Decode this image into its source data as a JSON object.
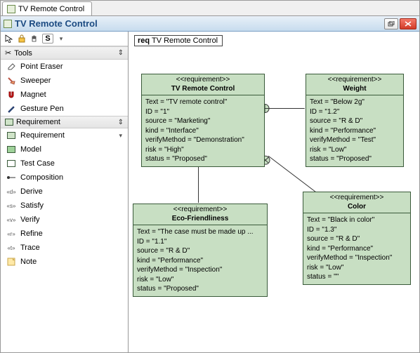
{
  "tab_title": "TV Remote Control",
  "window_title": "TV Remote Control",
  "toolstrip": {
    "lock": "S"
  },
  "sidebar": {
    "tools_header": "Tools",
    "tools": [
      {
        "label": "Point Eraser",
        "icon": "eraser-icon"
      },
      {
        "label": "Sweeper",
        "icon": "sweeper-icon"
      },
      {
        "label": "Magnet",
        "icon": "magnet-icon"
      },
      {
        "label": "Gesture Pen",
        "icon": "pen-icon"
      }
    ],
    "req_header": "Requirement",
    "req_items": [
      {
        "label": "Requirement",
        "icon": "req-icon"
      },
      {
        "label": "Model",
        "icon": "model-icon"
      },
      {
        "label": "Test Case",
        "icon": "testcase-icon"
      },
      {
        "label": "Composition",
        "icon": "composition-icon"
      },
      {
        "label": "Derive",
        "icon": "derive-icon"
      },
      {
        "label": "Satisfy",
        "icon": "satisfy-icon"
      },
      {
        "label": "Verify",
        "icon": "verify-icon"
      },
      {
        "label": "Refine",
        "icon": "refine-icon"
      },
      {
        "label": "Trace",
        "icon": "trace-icon"
      },
      {
        "label": "Note",
        "icon": "note-icon"
      }
    ]
  },
  "frame": {
    "keyword": "req",
    "name": "TV Remote Control"
  },
  "requirements": {
    "r1": {
      "stereo": "<<requirement>>",
      "name": "TV Remote Control",
      "body": "Text = \"TV remote control\"\nID = \"1\"\nsource = \"Marketing\"\nkind = \"Interface\"\nverifyMethod = \"Demonstration\"\nrisk = \"High\"\nstatus = \"Proposed\""
    },
    "r2": {
      "stereo": "<<requirement>>",
      "name": "Weight",
      "body": "Text = \"Below 2g\"\nID = \"1.2\"\nsource = \"R & D\"\nkind = \"Performance\"\nverifyMethod = \"Test\"\nrisk = \"Low\"\nstatus = \"Proposed\""
    },
    "r3": {
      "stereo": "<<requirement>>",
      "name": "Eco-Friendliness",
      "body": "Text = \"The case must be made up ...\nID = \"1.1\"\nsource = \"R & D\"\nkind = \"Performance\"\nverifyMethod = \"Inspection\"\nrisk = \"Low\"\nstatus = \"Proposed\""
    },
    "r4": {
      "stereo": "<<requirement>>",
      "name": "Color",
      "body": "Text = \"Black in color\"\nID = \"1.3\"\nsource = \"R & D\"\nkind = \"Performance\"\nverifyMethod = \"Inspection\"\nrisk = \"Low\"\nstatus = \"\""
    }
  }
}
